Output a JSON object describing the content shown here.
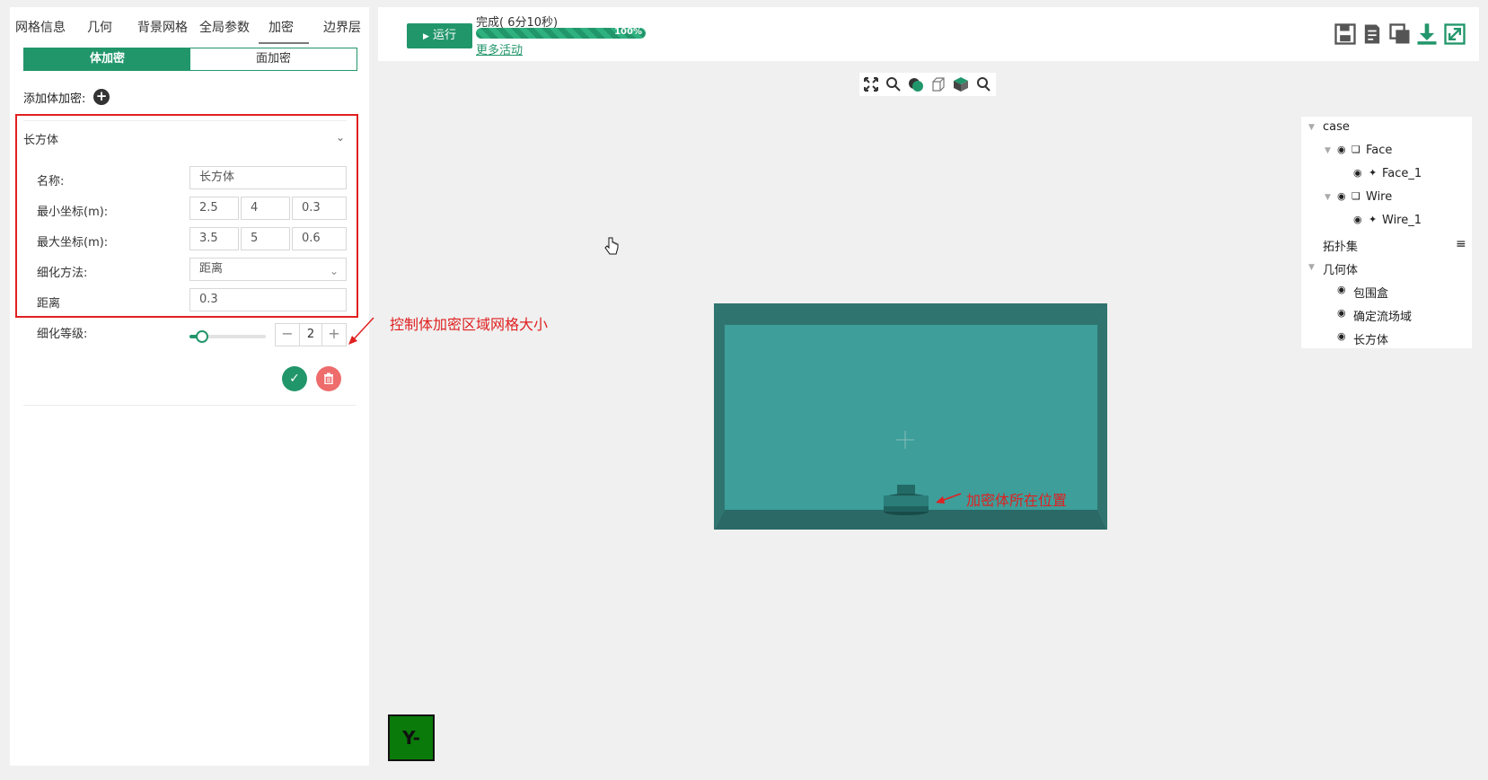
{
  "tabs": [
    "网格信息",
    "几何",
    "背景网格",
    "全局参数",
    "加密",
    "边界层"
  ],
  "subtabs": {
    "active": "体加密",
    "inactive": "面加密"
  },
  "add_label": "添加体加密:",
  "add_icon": "plus-circle-icon",
  "refine_item": {
    "title": "长方体",
    "name_label": "名称:",
    "name_value": "长方体",
    "min_label": "最小坐标(m):",
    "min": [
      "2.5",
      "4",
      "0.3"
    ],
    "max_label": "最大坐标(m):",
    "max": [
      "3.5",
      "5",
      "0.6"
    ],
    "method_label": "细化方法:",
    "method_value": "距离",
    "distance_label": "距离",
    "distance_value": "0.3",
    "level_label": "细化等级:",
    "level_value": "2",
    "slider_fraction": 0.1
  },
  "annotations": {
    "box_note": "控制体加密区域网格大小",
    "body_note": "加密体所在位置"
  },
  "toolbar": {
    "run_label": "运行",
    "status": "完成( 6分10秒)",
    "progress": 100,
    "progress_label": "100%",
    "more_link": "更多活动",
    "icons": [
      "save-icon",
      "report-icon",
      "copy-icon",
      "download-icon",
      "fullscreen-icon"
    ]
  },
  "view_tools": [
    "fit-view-icon",
    "zoom-icon",
    "shading-icon",
    "wireframe-icon",
    "solid-icon",
    "search-icon"
  ],
  "tree": {
    "root": "case",
    "face_group": "Face",
    "face_item": "Face_1",
    "wire_group": "Wire",
    "wire_item": "Wire_1",
    "topo_set": "拓扑集",
    "geometry": "几何体",
    "geo_items": [
      "包围盒",
      "确定流场域",
      "长方体"
    ]
  },
  "axis_label": "Y-",
  "colors": {
    "accent": "#22966b",
    "danger": "#ee6c6c",
    "annotation": "#e02020",
    "domain": "#3d9e9a"
  }
}
